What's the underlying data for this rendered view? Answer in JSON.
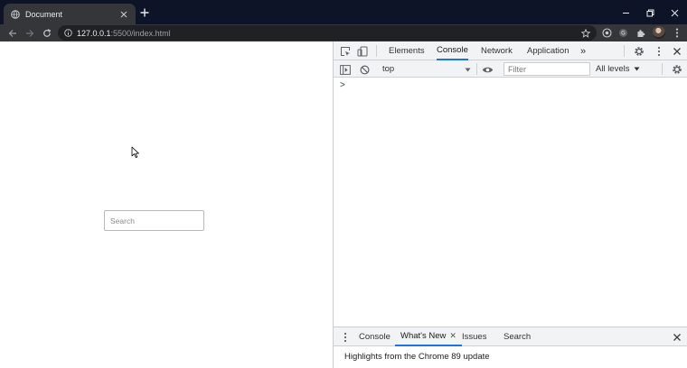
{
  "browser": {
    "tab": {
      "title": "Document",
      "favicon": "globe-icon"
    },
    "url": {
      "host": "127.0.0.1",
      "rest": ":5500/index.html"
    },
    "icons": {
      "back": "arrow-left-icon",
      "forward": "arrow-right-icon",
      "reload": "reload-icon",
      "info": "info-icon",
      "star": "star-icon",
      "extension1": "extension-icon",
      "extension2": "extension-icon",
      "extensions_menu": "puzzle-icon",
      "menu": "kebab-menu-icon"
    }
  },
  "page": {
    "search": {
      "placeholder": "Search",
      "value": ""
    }
  },
  "devtools": {
    "tabs": [
      {
        "label": "Elements",
        "active": false
      },
      {
        "label": "Console",
        "active": true
      },
      {
        "label": "Network",
        "active": false
      },
      {
        "label": "Application",
        "active": false
      }
    ],
    "more_tabs": "»",
    "console": {
      "context": "top",
      "filter_placeholder": "Filter",
      "levels": "All levels",
      "prompt": ">"
    },
    "drawer": {
      "tabs": [
        {
          "label": "Console",
          "active": false
        },
        {
          "label": "What's New",
          "active": true
        },
        {
          "label": "Issues",
          "active": false
        },
        {
          "label": "Search",
          "active": false
        }
      ],
      "close_glyph": "✕",
      "highlights": "Highlights from the Chrome 89 update"
    }
  },
  "colors": {
    "titlebar": "#0d1428",
    "toolbar": "#35363a",
    "omnibox": "#202124",
    "accent": "#1a73e8"
  }
}
